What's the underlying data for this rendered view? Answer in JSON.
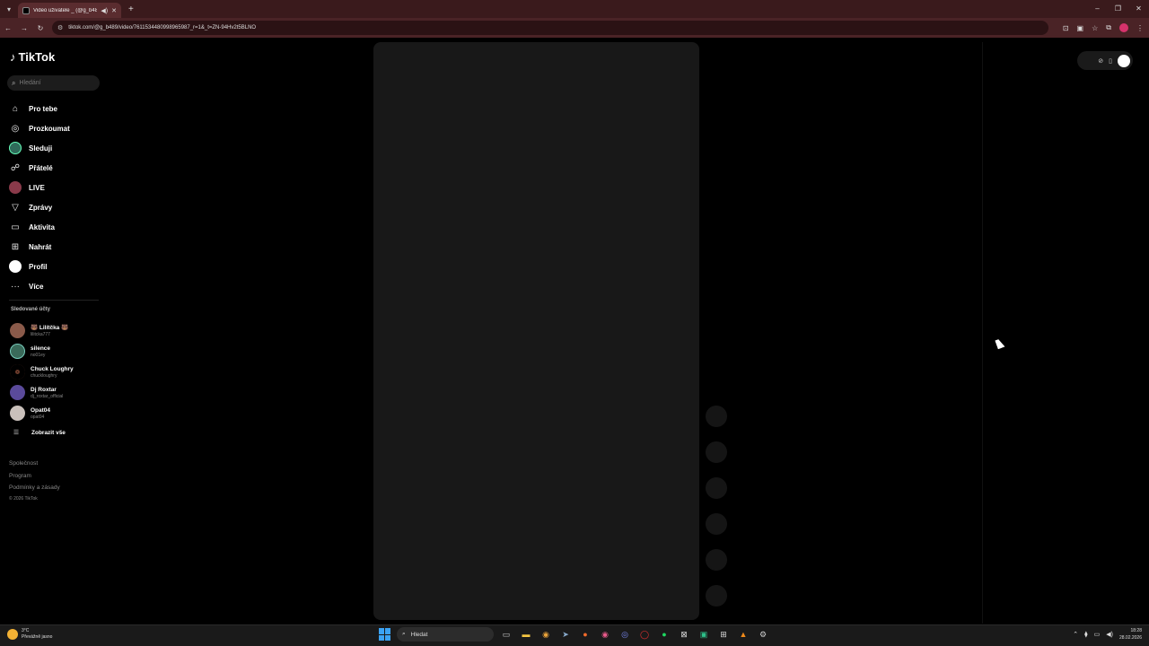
{
  "browser": {
    "tab_title": "Video uživatele _ (@g_b489",
    "url": "tiktok.com/@g_b489/video/7611534480998965987_r=1&_t=ZN-94Hv2t5BLNO",
    "window_controls": [
      "–",
      "❐",
      "✕"
    ],
    "new_tab": "+"
  },
  "sidebar": {
    "logo": "TikTok",
    "search_placeholder": "Hledání",
    "nav": [
      {
        "label": "Pro tebe",
        "icon": "home-icon",
        "glyph": "⌂"
      },
      {
        "label": "Prozkoumat",
        "icon": "compass-icon",
        "glyph": "◎"
      },
      {
        "label": "Sleduji",
        "icon": "following-avatar-icon",
        "glyph": ""
      },
      {
        "label": "Přátelé",
        "icon": "friends-icon",
        "glyph": "☍"
      },
      {
        "label": "LIVE",
        "icon": "live-icon",
        "glyph": ""
      },
      {
        "label": "Zprávy",
        "icon": "messages-icon",
        "glyph": "▽"
      },
      {
        "label": "Aktivita",
        "icon": "activity-icon",
        "glyph": "▭"
      },
      {
        "label": "Nahrát",
        "icon": "upload-icon",
        "glyph": "⊞"
      },
      {
        "label": "Profil",
        "icon": "profile-avatar-icon",
        "glyph": ""
      },
      {
        "label": "Více",
        "icon": "more-icon",
        "glyph": "···"
      }
    ],
    "followed_title": "Sledované účty",
    "followed": [
      {
        "name": "🐻 Lilítčka 🐻",
        "handle": "lilitcka777",
        "color": "#8a5a4a"
      },
      {
        "name": "silence",
        "handle": "no01ey",
        "color": "#3a6a5a"
      },
      {
        "name": "Chuck Loughry",
        "handle": "chuckloughry",
        "color": "#000000"
      },
      {
        "name": "Dj Roxtar",
        "handle": "dj_roxtar_official",
        "color": "#5a4a9a"
      },
      {
        "name": "Opat04",
        "handle": "opat04",
        "color": "#c9c0bb"
      }
    ],
    "show_all": "Zobrazit vše",
    "footer": [
      "Společnost",
      "Program",
      "Podmínky a zásady"
    ],
    "copyright": "© 2026 TikTok"
  },
  "taskbar": {
    "weather_temp": "3°C",
    "weather_desc": "Převážně jasno",
    "search_placeholder": "Hledat",
    "time": "18:28",
    "date": "28.02.2026"
  }
}
